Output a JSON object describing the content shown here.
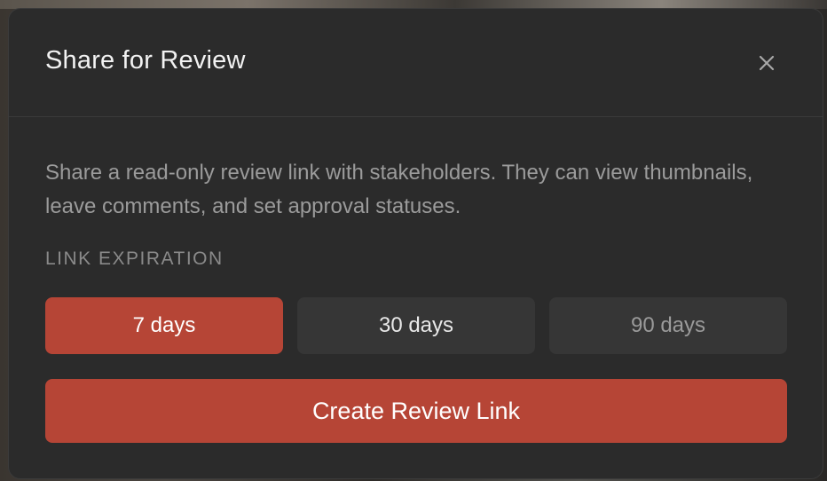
{
  "dialog": {
    "title": "Share for Review",
    "close_icon": "close-icon",
    "description": "Share a read-only review link with stakeholders. They can view thumbnails, leave comments, and set approval statuses.",
    "expiration_label": "LINK EXPIRATION",
    "expiration_options": [
      {
        "label": "7 days",
        "selected": true
      },
      {
        "label": "30 days",
        "selected": false
      },
      {
        "label": "90 days",
        "selected": false
      }
    ],
    "create_button_label": "Create Review Link"
  },
  "colors": {
    "accent": "#b64536",
    "modal_bg": "#2b2b2b",
    "option_bg": "#363636",
    "title_text": "#f2f2f2",
    "muted_text": "#9b9b9b"
  }
}
